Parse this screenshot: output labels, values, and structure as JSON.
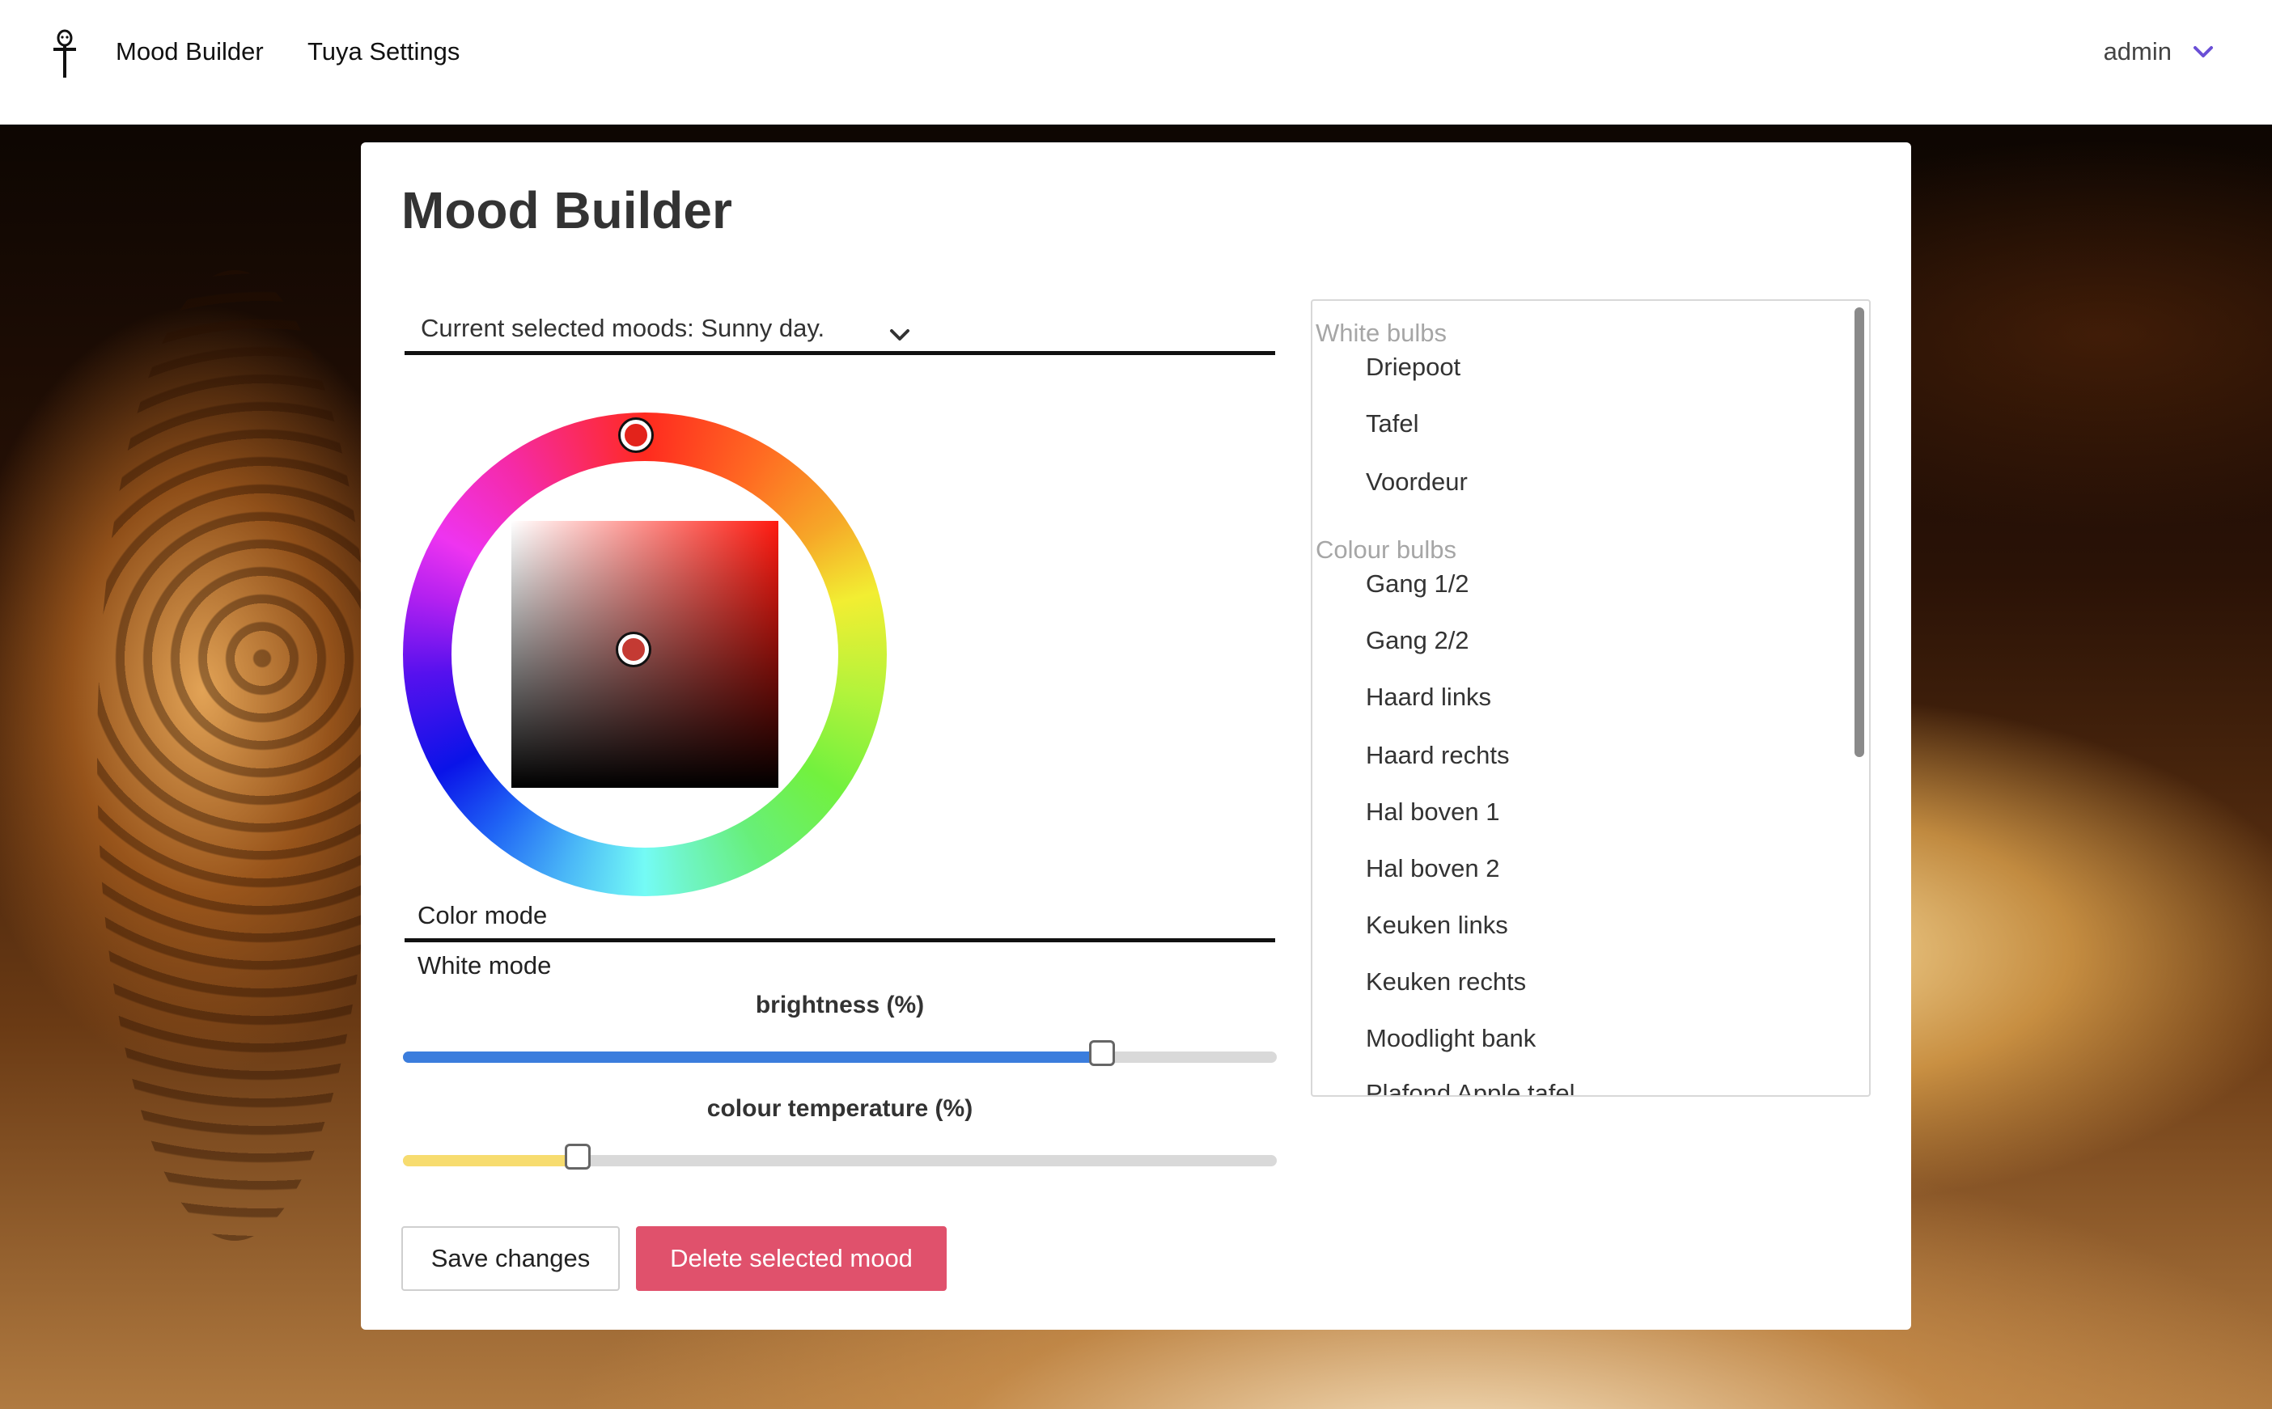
{
  "navbar": {
    "logo_icon": "ankh-figure-logo",
    "links": [
      {
        "label": "Mood Builder"
      },
      {
        "label": "Tuya Settings"
      }
    ],
    "user": {
      "label": "admin",
      "icon": "chevron-down-icon",
      "icon_color": "#6a4fd6"
    }
  },
  "page": {
    "title": "Mood Builder"
  },
  "mood_select": {
    "label": "Current selected moods: Sunny day.",
    "icon": "chevron-down-icon"
  },
  "color_picker": {
    "hue_handle_color": "#e3231b",
    "selected_color": "#c43a33"
  },
  "modes": {
    "color_label": "Color mode",
    "white_label": "White mode"
  },
  "sliders": {
    "brightness": {
      "label": "brightness (%)",
      "value": 80,
      "fill_color": "#3b7ddd"
    },
    "colour_temperature": {
      "label": "colour temperature (%)",
      "value": 20,
      "fill_color": "#f7dc6f"
    }
  },
  "buttons": {
    "save_label": "Save changes",
    "delete_label": "Delete selected mood",
    "delete_color": "#e0516c"
  },
  "bulbs": {
    "groups": [
      {
        "label": "White bulbs",
        "items": [
          "Driepoot",
          "Tafel",
          "Voordeur"
        ]
      },
      {
        "label": "Colour bulbs",
        "items": [
          "Gang 1/2",
          "Gang 2/2",
          "Haard links",
          "Haard rechts",
          "Hal boven 1",
          "Hal boven 2",
          "Keuken links",
          "Keuken rechts",
          "Moodlight bank",
          "Plafond Apple tafel"
        ]
      }
    ]
  }
}
